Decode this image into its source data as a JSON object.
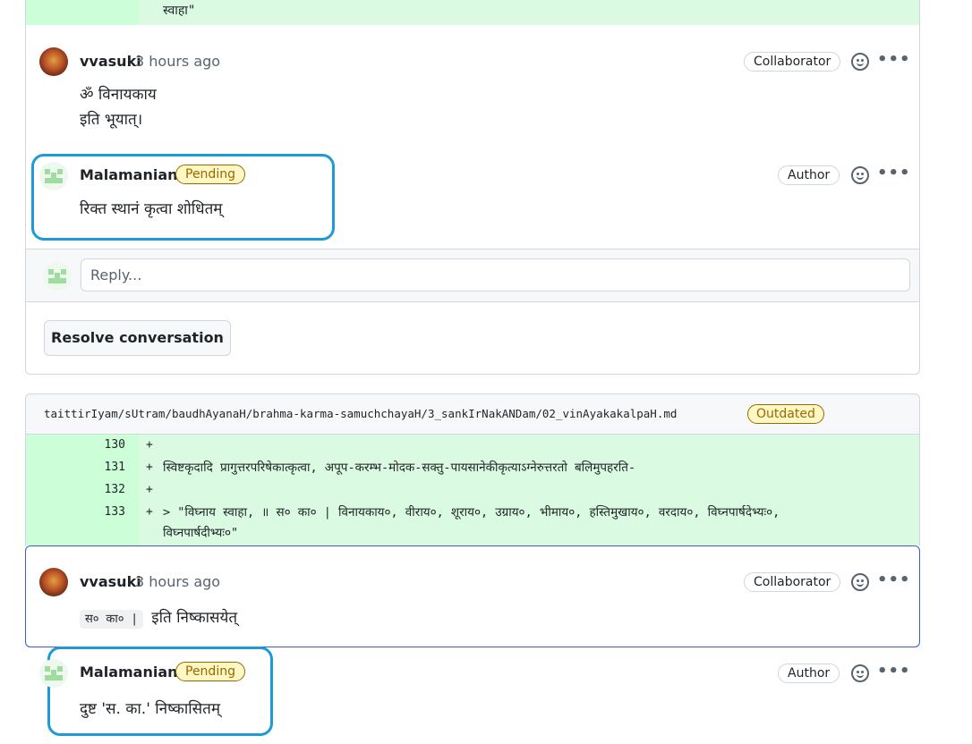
{
  "top_diff": {
    "code_tail": "स्वाहा\""
  },
  "thread1": {
    "comment1": {
      "author": "vvasuki",
      "time": "3 hours ago",
      "badge": "Collaborator",
      "lines": [
        "ॐ विनायकाय",
        "इति भूयात्।"
      ]
    },
    "comment2": {
      "author": "Malamanian",
      "status": "Pending",
      "badge": "Author",
      "text": "रिक्त स्थानं कृत्वा शोधितम्"
    },
    "reply_placeholder": "Reply...",
    "resolve_label": "Resolve conversation"
  },
  "file2": {
    "path": "taittirIyam/sUtram/baudhAyanaH/brahma-karma-samuchchayaH/3_sankIrNakANDam/02_vinAyakakalpaH.md",
    "status": "Outdated",
    "lines": [
      {
        "num": "130",
        "sign": "+",
        "code": ""
      },
      {
        "num": "131",
        "sign": "+",
        "code": "स्विष्टकृदादि प्रागुत्तरपरिषेकात्कृत्वा, अपूप-करम्भ-मोदक-सक्तु-पायसानेकीकृत्याऽग्नेरुत्तरतो बलिमुपहरति-"
      },
      {
        "num": "132",
        "sign": "+",
        "code": ""
      },
      {
        "num": "133",
        "sign": "+",
        "code": "> \"विघ्नाय स्वाहा, ॥ स० का० | विनायकाय०, वीराय०, शूराय०, उग्राय०, भीमाय०, हस्तिमुखाय०, वरदाय०, विघ्नपार्षदेभ्यः०,"
      },
      {
        "num": "",
        "sign": "",
        "code": "विघ्नपार्षदीभ्यः०\""
      }
    ]
  },
  "thread2": {
    "comment1": {
      "author": "vvasuki",
      "time": "3 hours ago",
      "badge": "Collaborator",
      "code_chip": "स० का० |",
      "text": "इति निष्कासयेत्"
    },
    "comment2": {
      "author": "Malamanian",
      "status": "Pending",
      "badge": "Author",
      "text": "दुष्ट 'स. का.' निष्कासितम्"
    }
  },
  "colors": {
    "highlight": "#1e9ad6",
    "diff_add": "#dafbe1",
    "pending": "#9a6700"
  }
}
